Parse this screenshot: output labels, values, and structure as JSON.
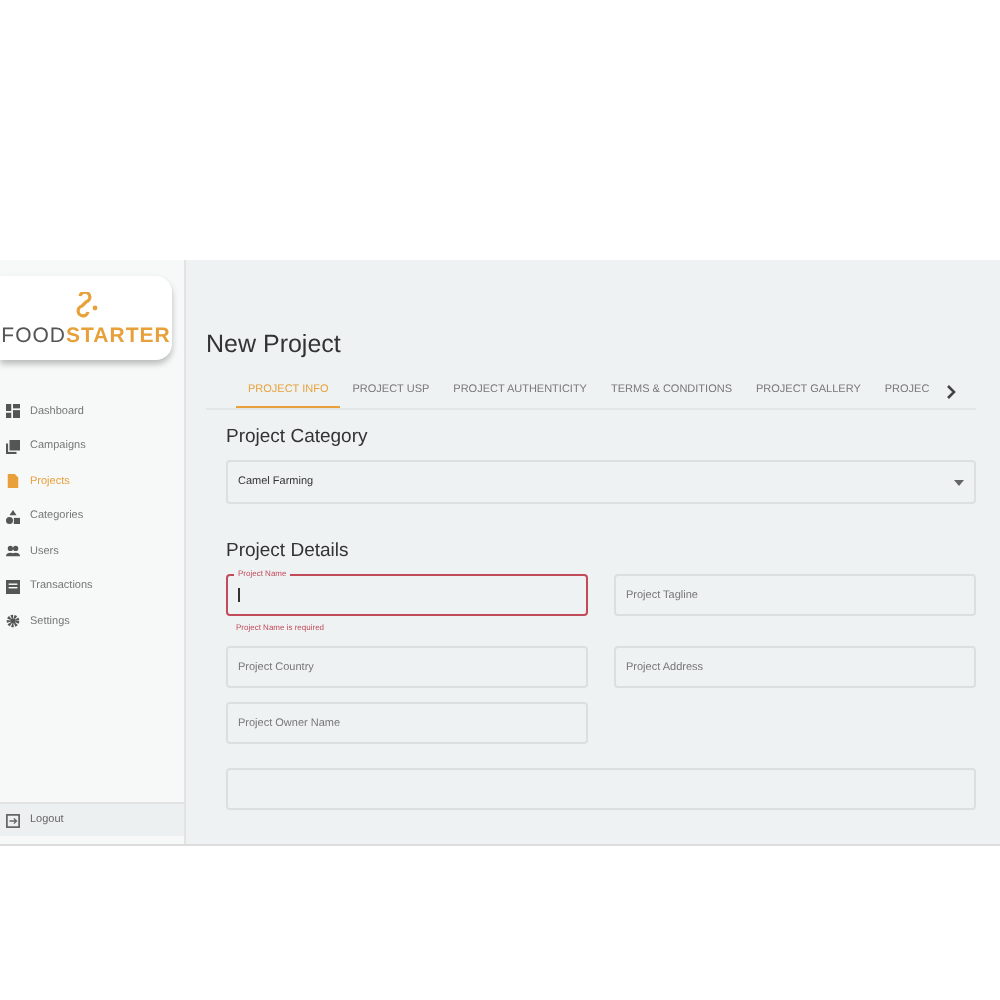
{
  "logo": {
    "word_1": "FOOD",
    "word_2": "STARTER"
  },
  "sidebar": {
    "items": [
      {
        "label": "Dashboard",
        "kind": "dashboard",
        "selected": false
      },
      {
        "label": "Campaigns",
        "kind": "campaigns",
        "selected": false
      },
      {
        "label": "Projects",
        "kind": "projects",
        "selected": true
      },
      {
        "label": "Categories",
        "kind": "categories",
        "selected": false
      },
      {
        "label": "Users",
        "kind": "users",
        "selected": false
      },
      {
        "label": "Transactions",
        "kind": "transactions",
        "selected": false
      },
      {
        "label": "Settings",
        "kind": "settings",
        "selected": false
      }
    ],
    "logout": "Logout"
  },
  "page_title": "New Project",
  "tabs": [
    {
      "label": "PROJECT INFO",
      "selected": true
    },
    {
      "label": "PROJECT USP",
      "selected": false
    },
    {
      "label": "PROJECT AUTHENTICITY",
      "selected": false
    },
    {
      "label": "TERMS & CONDITIONS",
      "selected": false
    },
    {
      "label": "PROJECT GALLERY",
      "selected": false
    },
    {
      "label": "PROJEC",
      "selected": false
    }
  ],
  "category_section": {
    "title": "Project Category",
    "value": "Camel Farming"
  },
  "details_section": {
    "title": "Project Details",
    "fields": [
      {
        "label": "Project Name",
        "error": "Project Name is required",
        "focused": true
      },
      {
        "placeholder": "Project Tagline",
        "focused": false
      },
      {
        "placeholder": "Project Country",
        "focused": false
      },
      {
        "placeholder": "Project Address",
        "focused": false
      },
      {
        "placeholder": "Project Owner Name",
        "focused": false
      }
    ]
  }
}
